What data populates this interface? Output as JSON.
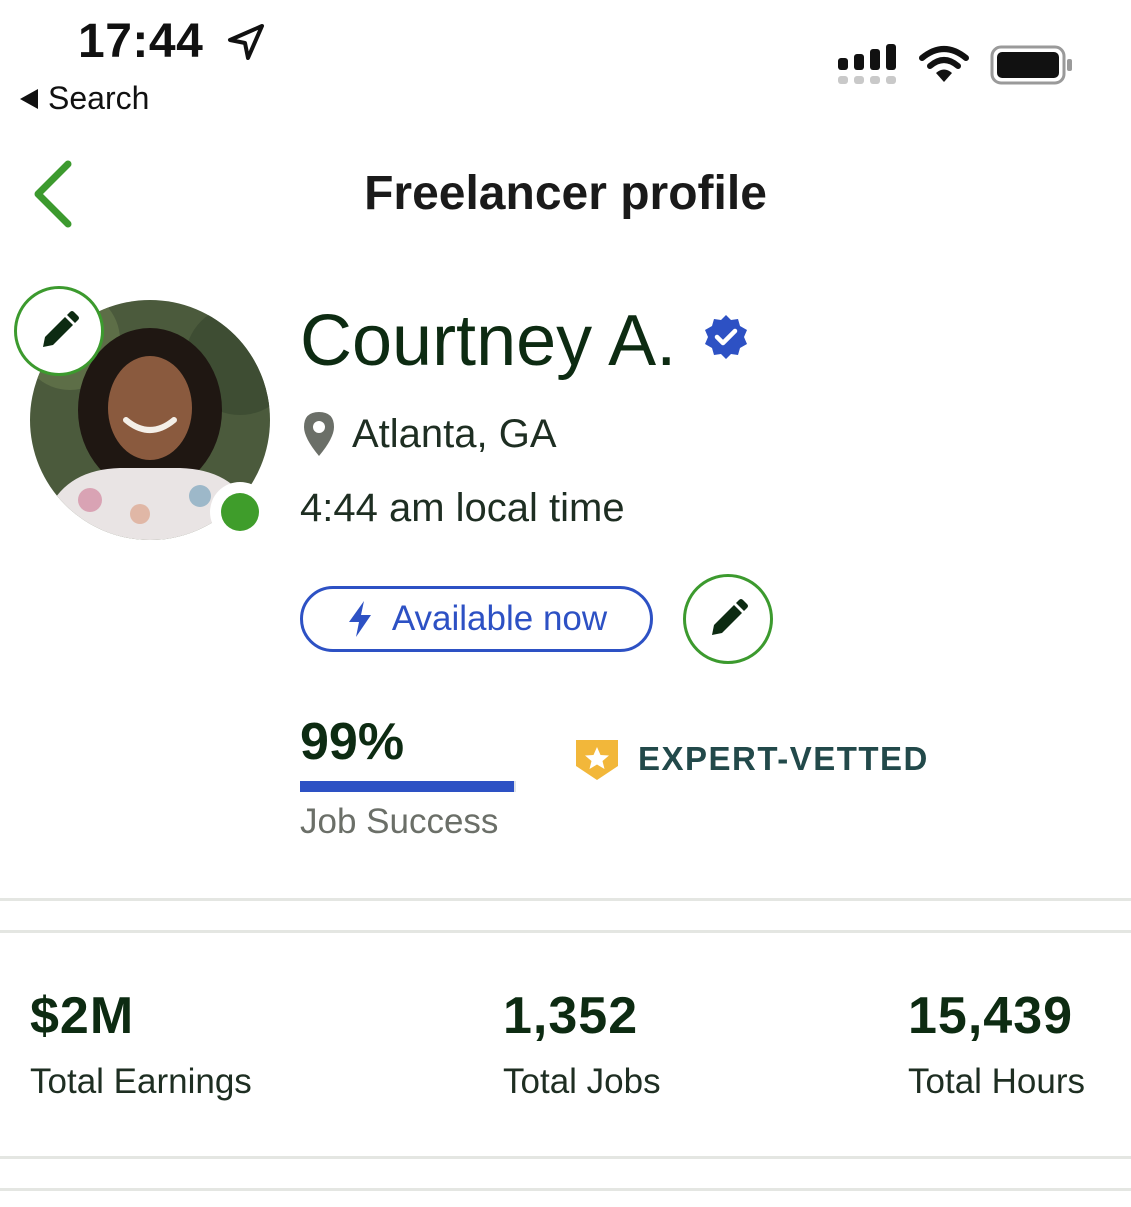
{
  "status_bar": {
    "time": "17:44",
    "back_app_label": "Search"
  },
  "header": {
    "title": "Freelancer profile"
  },
  "profile": {
    "name": "Courtney A.",
    "location": "Atlanta, GA",
    "local_time": "4:44 am local time",
    "availability_label": "Available now",
    "online": true,
    "verified": true
  },
  "job_success": {
    "value": "99%",
    "fraction": 0.99,
    "label": "Job Success"
  },
  "badge": {
    "label": "EXPERT-VETTED"
  },
  "stats": [
    {
      "value": "$2M",
      "label": "Total Earnings"
    },
    {
      "value": "1,352",
      "label": "Total Jobs"
    },
    {
      "value": "15,439",
      "label": "Total Hours"
    }
  ],
  "colors": {
    "brand_green": "#3c9a2e",
    "accent_blue": "#2d51c4",
    "text_dark": "#0d2b12",
    "badge_gold": "#f2b73a"
  },
  "icons": [
    "location-arrow-icon",
    "back-triangle-icon",
    "signal-icon",
    "wifi-icon",
    "battery-icon",
    "chevron-left-icon",
    "pencil-icon",
    "verified-badge-icon",
    "map-pin-icon",
    "lightning-bolt-icon",
    "expert-vetted-shield-icon"
  ]
}
